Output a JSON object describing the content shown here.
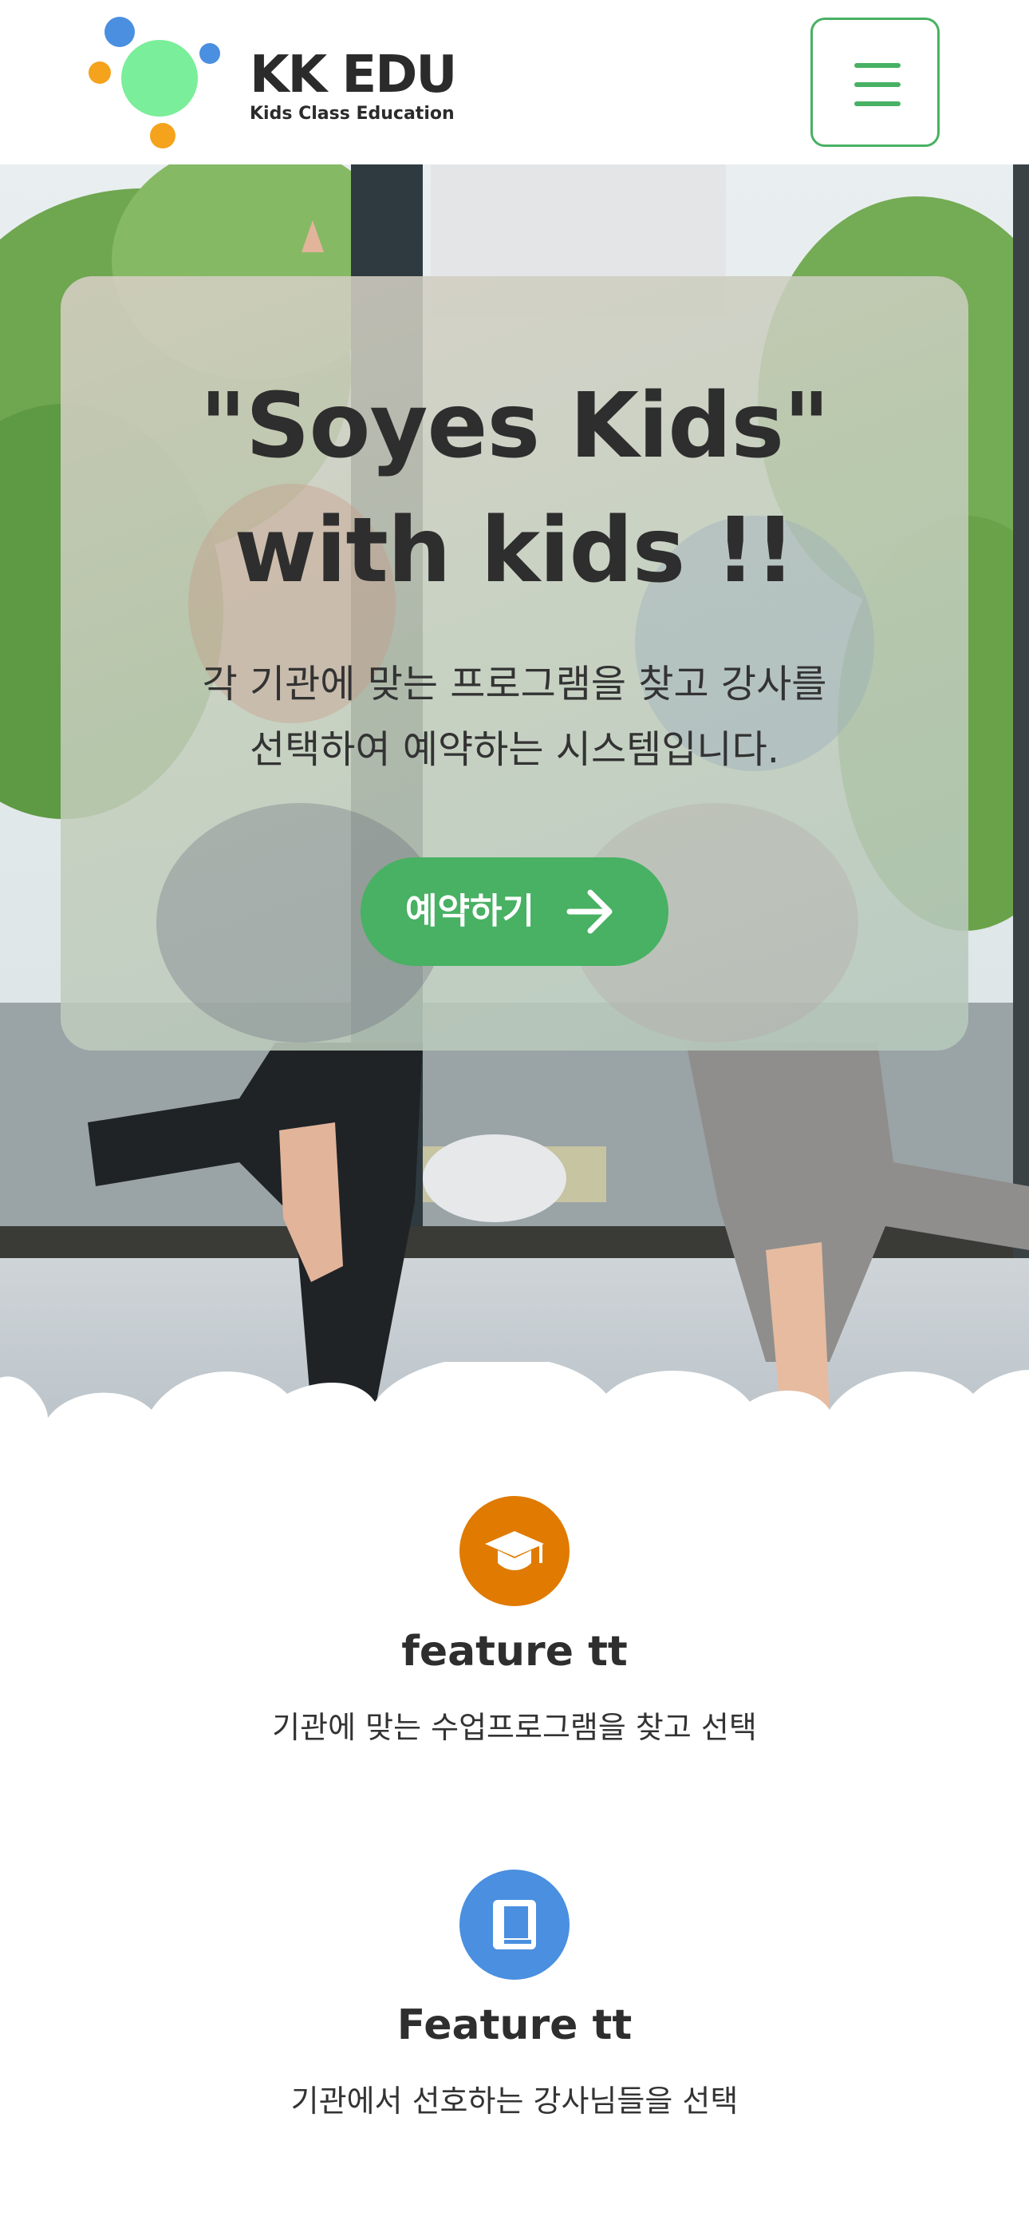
{
  "header": {
    "logo_title": "KK EDU",
    "logo_subtitle": "Kids Class Education",
    "menu_icon": "hamburger-menu-icon"
  },
  "hero": {
    "title_line1": "\"Soyes Kids\"",
    "title_line2": "with kids !!",
    "description_line1": "각 기관에 맞는 프로그램을 찾고 강사를",
    "description_line2": "선택하여 예약하는 시스템입니다.",
    "cta_label": "예약하기",
    "cta_icon": "arrow-right-icon"
  },
  "features": [
    {
      "icon": "graduation-cap-icon",
      "icon_color": "#e07a00",
      "title": "feature tt",
      "description": "기관에 맞는 수업프로그램을 찾고 선택"
    },
    {
      "icon": "book-icon",
      "icon_color": "#4a8fe0",
      "title": "Feature tt",
      "description": "기관에서 선호하는 강사님들을 선택"
    }
  ],
  "colors": {
    "accent": "#48b163",
    "text": "#333333",
    "logo_green": "#7aee9a",
    "logo_blue": "#4a8fe0",
    "logo_orange": "#f5a21c"
  }
}
